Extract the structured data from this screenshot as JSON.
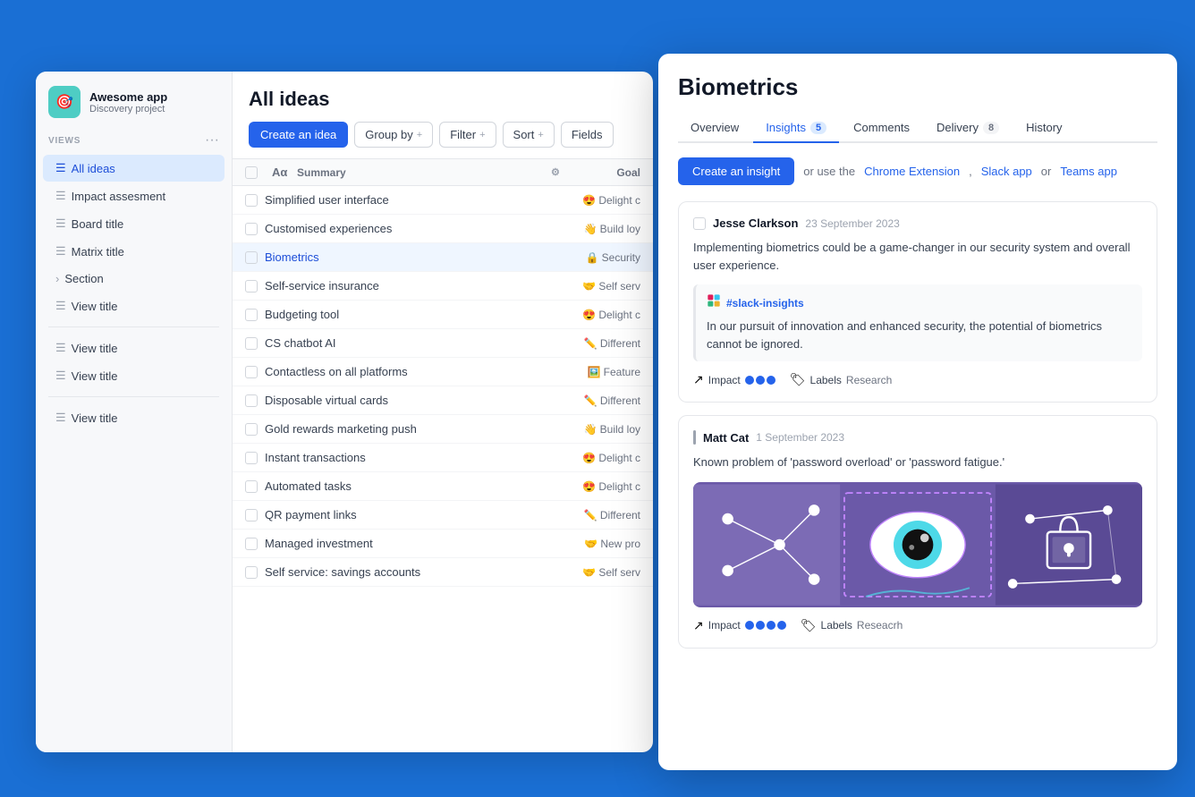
{
  "app": {
    "name": "Awesome app",
    "subtitle": "Discovery project",
    "icon": "🎯"
  },
  "sidebar": {
    "views_label": "VIEWS",
    "items": [
      {
        "label": "All ideas",
        "active": true,
        "icon": "list"
      },
      {
        "label": "Impact assesment",
        "active": false,
        "icon": "list"
      },
      {
        "label": "Board title",
        "active": false,
        "icon": "list"
      },
      {
        "label": "Matrix title",
        "active": false,
        "icon": "list"
      },
      {
        "label": "Section",
        "active": false,
        "icon": "chevron"
      },
      {
        "label": "View title",
        "active": false,
        "icon": "list"
      }
    ],
    "items2": [
      {
        "label": "View title",
        "active": false,
        "icon": "list"
      },
      {
        "label": "View title",
        "active": false,
        "icon": "list"
      }
    ],
    "items3": [
      {
        "label": "View title",
        "active": false,
        "icon": "list"
      }
    ]
  },
  "ideas": {
    "title": "All ideas",
    "toolbar": {
      "create_label": "Create an idea",
      "group_by_label": "Group by",
      "filter_label": "Filter",
      "sort_label": "Sort",
      "fields_label": "Fields"
    },
    "table": {
      "col_summary": "Summary",
      "col_goal": "Goal",
      "rows": [
        {
          "name": "Simplified user interface",
          "goal_emoji": "😍",
          "goal_text": "Delight c"
        },
        {
          "name": "Customised experiences",
          "goal_emoji": "👋",
          "goal_text": "Build loy"
        },
        {
          "name": "Biometrics",
          "goal_emoji": "🔒",
          "goal_text": "Security",
          "selected": true
        },
        {
          "name": "Self-service insurance",
          "goal_emoji": "🤝",
          "goal_text": "Self serv"
        },
        {
          "name": "Budgeting tool",
          "goal_emoji": "😍",
          "goal_text": "Delight c"
        },
        {
          "name": "CS chatbot AI",
          "goal_emoji": "✏️",
          "goal_text": "Different"
        },
        {
          "name": "Contactless on all platforms",
          "goal_emoji": "🖼️",
          "goal_text": "Feature"
        },
        {
          "name": "Disposable virtual cards",
          "goal_emoji": "✏️",
          "goal_text": "Different"
        },
        {
          "name": "Gold rewards marketing push",
          "goal_emoji": "👋",
          "goal_text": "Build loy"
        },
        {
          "name": "Instant transactions",
          "goal_emoji": "😍",
          "goal_text": "Delight c"
        },
        {
          "name": "Automated tasks",
          "goal_emoji": "😍",
          "goal_text": "Delight c"
        },
        {
          "name": "QR payment links",
          "goal_emoji": "✏️",
          "goal_text": "Different"
        },
        {
          "name": "Managed investment",
          "goal_emoji": "🤝",
          "goal_text": "New pro"
        },
        {
          "name": "Self service: savings accounts",
          "goal_emoji": "🤝",
          "goal_text": "Self serv"
        }
      ]
    }
  },
  "detail": {
    "title": "Biometrics",
    "tabs": [
      {
        "label": "Overview",
        "active": false,
        "badge": null
      },
      {
        "label": "Insights",
        "active": true,
        "badge": "5"
      },
      {
        "label": "Comments",
        "active": false,
        "badge": null
      },
      {
        "label": "Delivery",
        "active": false,
        "badge": "8"
      },
      {
        "label": "History",
        "active": false,
        "badge": null
      }
    ],
    "create_insight_label": "Create an insight",
    "create_insight_or": "or use the",
    "chrome_ext": "Chrome Extension",
    "slack_app": "Slack app",
    "teams_app": "Teams app",
    "insights": [
      {
        "author": "Jesse Clarkson",
        "date": "23 September 2023",
        "text": "Implementing biometrics could be a game-changer in our security system and overall user experience.",
        "has_slack": true,
        "slack_channel": "#slack-insights",
        "slack_text": "In our pursuit of innovation and enhanced security, the potential of biometrics cannot be ignored.",
        "impact_dots": 3,
        "labels_label": "Labels",
        "labels_value": "Research"
      },
      {
        "author": "Matt Cat",
        "date": "1 September 2023",
        "text": "Known problem of 'password overload' or 'password fatigue.'",
        "has_slack": false,
        "has_image": true,
        "impact_dots": 4,
        "labels_label": "Labels",
        "labels_value": "Reseacrh"
      }
    ]
  }
}
